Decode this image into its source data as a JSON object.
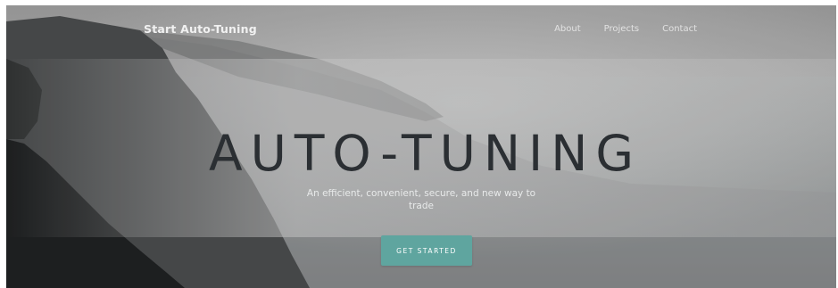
{
  "nav": {
    "brand": "Start Auto-Tuning",
    "links": [
      {
        "label": "About"
      },
      {
        "label": "Projects"
      },
      {
        "label": "Contact"
      }
    ]
  },
  "hero": {
    "title": "AUTO-TUNING",
    "subtitle": "An efficient, convenient, secure, and new way to trade",
    "cta_label": "GET STARTED"
  },
  "colors": {
    "accent": "#5fa59f",
    "title_text": "#2b2f33",
    "nav_text": "#e9e9e9"
  }
}
